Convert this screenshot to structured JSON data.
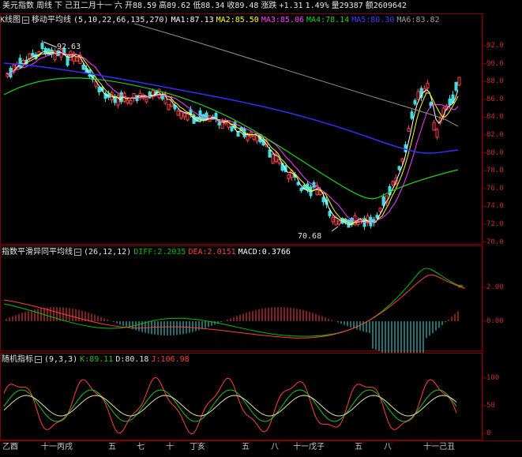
{
  "header": {
    "items": [
      {
        "text": "美元指数",
        "color": "#e8e8e8"
      },
      {
        "text": "周线",
        "color": "#e8e8e8"
      },
      {
        "text": "下",
        "color": "#e8e8e8"
      },
      {
        "text": "己丑二月十一",
        "color": "#e8e8e8"
      },
      {
        "text": "六",
        "color": "#e8e8e8"
      },
      {
        "text": "开88.59",
        "color": "#e8e8e8"
      },
      {
        "text": "高89.62",
        "color": "#e8e8e8"
      },
      {
        "text": "低88.34",
        "color": "#e8e8e8"
      },
      {
        "text": "收89.48",
        "color": "#e8e8e8"
      },
      {
        "text": "涨跌",
        "color": "#e8e8e8"
      },
      {
        "text": "+1.31",
        "color": "#e8e8e8"
      },
      {
        "text": "1.49%",
        "color": "#e8e8e8"
      },
      {
        "text": "量29387",
        "color": "#e8e8e8"
      },
      {
        "text": "额2609642",
        "color": "#e8e8e8"
      }
    ]
  },
  "main_panel": {
    "indicator_prefix": "K线图",
    "indicator_name": "移动平均线",
    "params": "(5,10,22,66,135,270)",
    "values": [
      {
        "text": "MA1:87.13",
        "color": "#ffffff"
      },
      {
        "text": "MA2:85.50",
        "color": "#ffff00"
      },
      {
        "text": "MA3:85.06",
        "color": "#ff40ff"
      },
      {
        "text": "MA4:78.14",
        "color": "#20d020"
      },
      {
        "text": "MA5:80.30",
        "color": "#4040ff"
      },
      {
        "text": "MA6:83.82",
        "color": "#a0a0a0"
      }
    ],
    "y_labels": [
      "92.0",
      "90.0",
      "88.0",
      "86.0",
      "84.0",
      "82.0",
      "80.0",
      "78.0",
      "76.0",
      "74.0",
      "72.0",
      "70.0"
    ],
    "high_label": "92.63",
    "low_label": "70.68"
  },
  "macd_panel": {
    "indicator_name": "指数平滑异同平均线",
    "params": "(26,12,12)",
    "values": [
      {
        "text": "DIFF:2.2035",
        "color": "#00c000"
      },
      {
        "text": "DEA:2.0151",
        "color": "#ff4040"
      },
      {
        "text": "MACD:0.3766",
        "color": "#ffffff"
      }
    ],
    "y_labels": [
      "2.00",
      "0.00"
    ]
  },
  "kdj_panel": {
    "indicator_name": "随机指标",
    "params": "(9,3,3)",
    "values": [
      {
        "text": "K:89.11",
        "color": "#20c020"
      },
      {
        "text": "D:80.18",
        "color": "#e0e0e0"
      },
      {
        "text": "J:106.98",
        "color": "#ff4040"
      }
    ],
    "y_labels": [
      "100",
      "50",
      "0"
    ]
  },
  "x_axis": {
    "labels": [
      "乙酉",
      "十一丙戌",
      "五",
      "七",
      "十",
      "丁亥",
      "五",
      "八",
      "十一戊子",
      "五",
      "八",
      "十一己丑"
    ]
  },
  "colors": {
    "up": "#ff4040",
    "down": "#40e0e0",
    "grid": "#800000",
    "axis_text": "#c03030"
  }
}
